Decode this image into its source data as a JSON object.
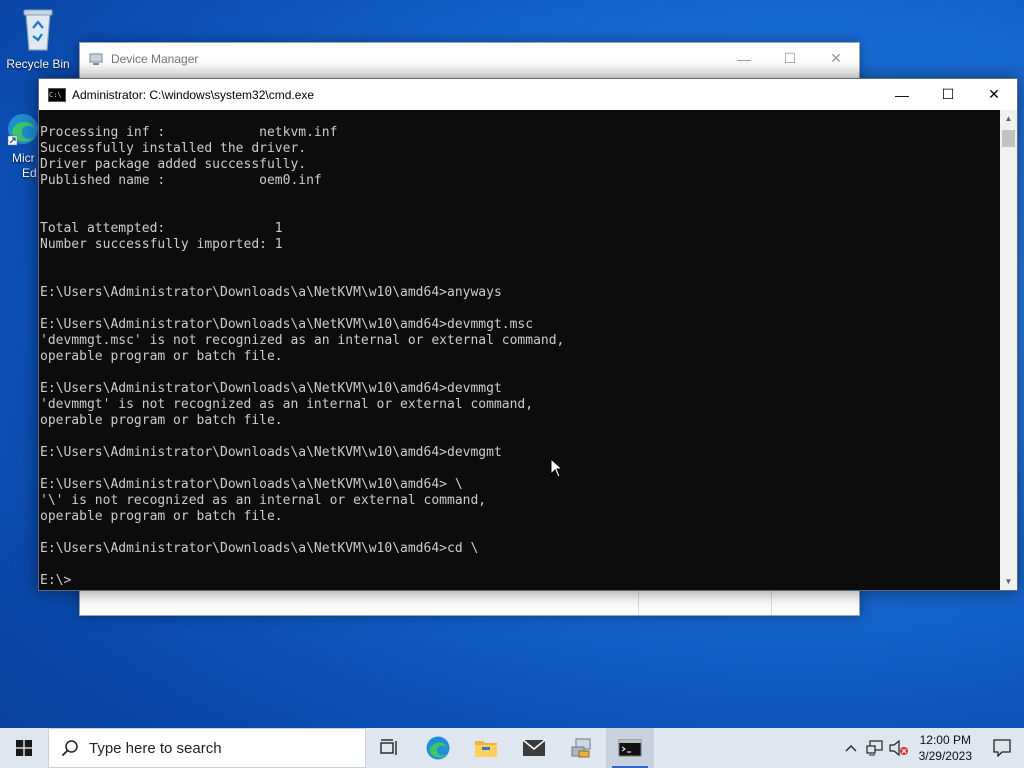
{
  "desktop": {
    "recycle_bin_label": "Recycle Bin",
    "edge_label_line1": "Micr",
    "edge_label_line2": "Ed"
  },
  "device_manager": {
    "title": "Device Manager"
  },
  "cmd": {
    "title": "Administrator: C:\\windows\\system32\\cmd.exe",
    "lines": [
      "Processing inf :            netkvm.inf",
      "Successfully installed the driver.",
      "Driver package added successfully.",
      "Published name :            oem0.inf",
      "",
      "",
      "Total attempted:              1",
      "Number successfully imported: 1",
      "",
      "",
      "E:\\Users\\Administrator\\Downloads\\a\\NetKVM\\w10\\amd64>anyways",
      "",
      "E:\\Users\\Administrator\\Downloads\\a\\NetKVM\\w10\\amd64>devmmgt.msc",
      "'devmmgt.msc' is not recognized as an internal or external command,",
      "operable program or batch file.",
      "",
      "E:\\Users\\Administrator\\Downloads\\a\\NetKVM\\w10\\amd64>devmmgt",
      "'devmmgt' is not recognized as an internal or external command,",
      "operable program or batch file.",
      "",
      "E:\\Users\\Administrator\\Downloads\\a\\NetKVM\\w10\\amd64>devmgmt",
      "",
      "E:\\Users\\Administrator\\Downloads\\a\\NetKVM\\w10\\amd64> \\",
      "'\\' is not recognized as an internal or external command,",
      "operable program or batch file.",
      "",
      "E:\\Users\\Administrator\\Downloads\\a\\NetKVM\\w10\\amd64>cd \\",
      "",
      "E:\\>"
    ]
  },
  "taskbar": {
    "search_placeholder": "Type here to search",
    "apps": [
      "task-view",
      "edge",
      "file-explorer",
      "mail",
      "device-manager",
      "command-prompt"
    ],
    "time": "12:00 PM",
    "date": "3/29/2023"
  },
  "colors": {
    "console_bg": "#0c0c0c",
    "console_fg": "#cccccc",
    "taskbar_bg": "#dfe6ef",
    "accent": "#2a6ad0"
  }
}
